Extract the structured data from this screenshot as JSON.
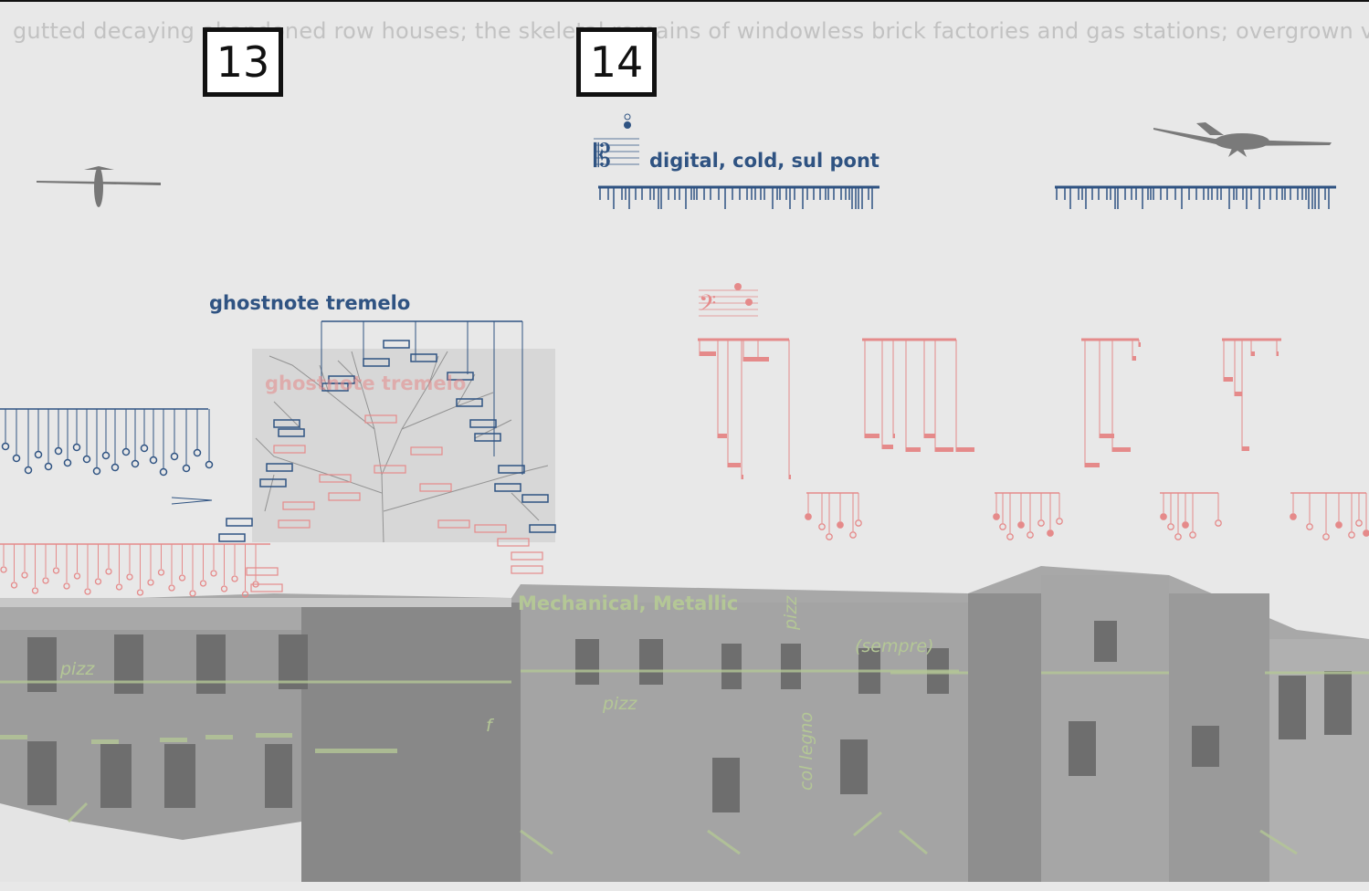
{
  "score": {
    "scrolling_text": "gutted decaying abandoned row houses; the skeletal remains of windowless brick factories and gas stations; overgrown vacant",
    "rehearsal_marks": [
      "13",
      "14"
    ],
    "performance_notes": {
      "viola": "digital, cold, sul pont",
      "ghostnote": "ghostnote tremelo",
      "ghostnote_pink": "ghostnote tremelo",
      "mechanical": "Mechanical, Metallic",
      "sempre": "(sempre)",
      "pizz_1": "pizz",
      "pizz_2": "pizz",
      "pizz_3": "pizz",
      "dyn_f": "f",
      "col_legno": "col legno"
    },
    "icons": [
      "drone-icon",
      "alto-clef-icon",
      "bass-clef-icon"
    ],
    "colors": {
      "blue": "#2f5382",
      "pink": "#e58a8a",
      "green": "#b4c796",
      "building": "#9a9a9a",
      "background": "#e8e8e8"
    }
  }
}
